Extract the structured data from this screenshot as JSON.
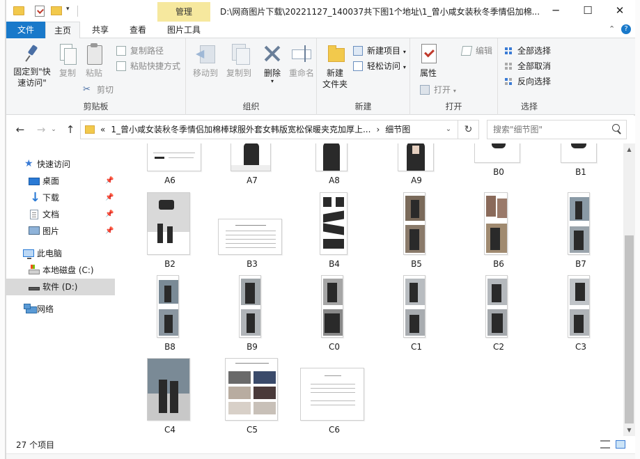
{
  "window": {
    "title": "D:\\网商图片下载\\20221127_140037共下图1个地址\\1_曾小咸女装秋冬季情侣加棉...",
    "context_tab": "管理",
    "controls": {
      "minimize": "─",
      "maximize": "☐",
      "close": "✕"
    }
  },
  "tabs": [
    "文件",
    "主页",
    "共享",
    "查看",
    "图片工具"
  ],
  "ribbon": {
    "clipboard": {
      "label": "剪贴板",
      "pin": "固定到\"快速访问\"",
      "copy": "复制",
      "paste": "粘贴",
      "copy_path": "复制路径",
      "paste_shortcut": "粘贴快捷方式",
      "cut": "剪切"
    },
    "organize": {
      "label": "组织",
      "move_to": "移动到",
      "copy_to": "复制到",
      "delete": "删除",
      "rename": "重命名"
    },
    "new": {
      "label": "新建",
      "new_folder": "新建\n文件夹",
      "new_item": "新建项目",
      "easy_access": "轻松访问"
    },
    "open": {
      "label": "打开",
      "properties": "属性",
      "open": "打开",
      "edit": "编辑"
    },
    "select": {
      "label": "选择",
      "select_all": "全部选择",
      "select_none": "全部取消",
      "invert": "反向选择"
    }
  },
  "address": {
    "prefix": "«",
    "crumbs": [
      "1_曾小咸女装秋冬季情侣加棉棒球服外套女韩版宽松保暖夹克加厚上...",
      "›",
      "细节图"
    ],
    "search_placeholder": "搜索\"细节图\""
  },
  "nav": {
    "quick_access": "快速访问",
    "desktop": "桌面",
    "downloads": "下载",
    "documents": "文档",
    "pictures": "图片",
    "this_pc": "此电脑",
    "local_c": "本地磁盘 (C:)",
    "soft_d": "软件 (D:)",
    "network": "网络"
  },
  "files": [
    "A6",
    "A7",
    "A8",
    "A9",
    "B0",
    "B1",
    "B2",
    "B3",
    "B4",
    "B5",
    "B6",
    "B7",
    "B8",
    "B9",
    "C0",
    "C1",
    "C2",
    "C3",
    "C4",
    "C5",
    "C6"
  ],
  "status": {
    "count": "27 个项目"
  }
}
